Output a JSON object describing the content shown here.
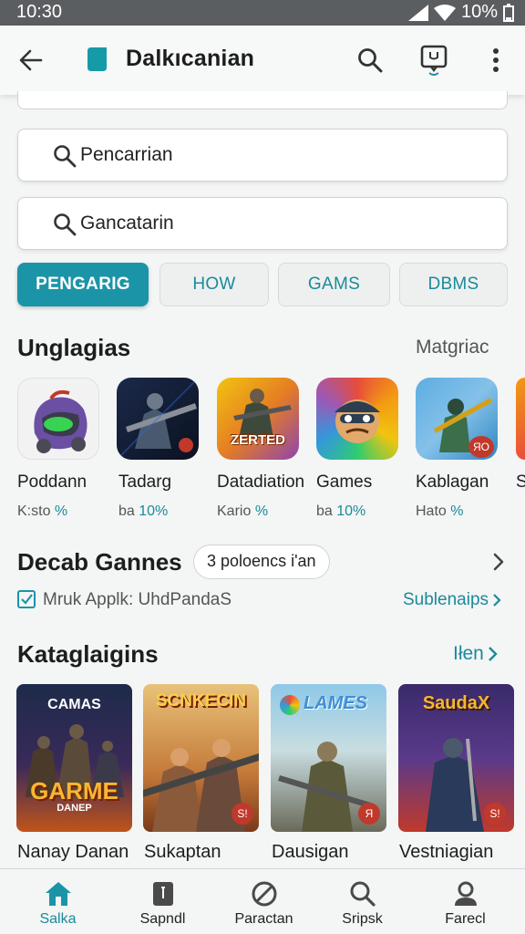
{
  "status": {
    "time": "10:30",
    "battery": "10%"
  },
  "header": {
    "title": "Dalkıcanian"
  },
  "search": [
    {
      "placeholder": "Pencarrian"
    },
    {
      "placeholder": "Gancatarin"
    }
  ],
  "chips": [
    "PENGARIG",
    "HOW",
    "GAMS",
    "DBMS"
  ],
  "section1": {
    "title": "Unglagias",
    "more": "Matgriac",
    "apps": [
      {
        "name": "Poddann",
        "sub": "K:sto",
        "pct": "%"
      },
      {
        "name": "Tadarg",
        "sub": "ba",
        "pct": "10%"
      },
      {
        "name": "Datadiation",
        "sub": "Kario",
        "pct": "%",
        "icon_text": "ZERTED"
      },
      {
        "name": "Games",
        "sub": "ba",
        "pct": "10%"
      },
      {
        "name": "Kablagan",
        "sub": "Hato",
        "pct": "%",
        "badge": "ЯO"
      },
      {
        "name": "S"
      }
    ]
  },
  "section2": {
    "title": "Decab Gannes",
    "pill": "3 poloencs i'an",
    "check_label": "Mruk Applk: UhdPandaS",
    "link": "Sublenaips"
  },
  "section3": {
    "title": "Kataglaigins",
    "more": "Iłen",
    "cards": [
      {
        "name": "Nanay Danan",
        "top_text": "CAMAS",
        "bottom_text": "GARME",
        "bottom_sub": "DANEP"
      },
      {
        "name": "Sukaptan",
        "top_text": "SCNKECIN",
        "badge": "S!"
      },
      {
        "name": "Dausigan",
        "top_text": "LAMES",
        "badge": "Я"
      },
      {
        "name": "Vestniagian",
        "top_text": "SaudaX",
        "badge": "S!"
      }
    ]
  },
  "nav": [
    {
      "label": "Salka",
      "icon": "home-icon"
    },
    {
      "label": "Sapndl",
      "icon": "book-icon"
    },
    {
      "label": "Paractan",
      "icon": "block-icon"
    },
    {
      "label": "Sripsk",
      "icon": "search-icon"
    },
    {
      "label": "Farecl",
      "icon": "person-icon"
    }
  ],
  "colors": {
    "accent": "#1c94a8",
    "text": "#1d1d1f"
  }
}
